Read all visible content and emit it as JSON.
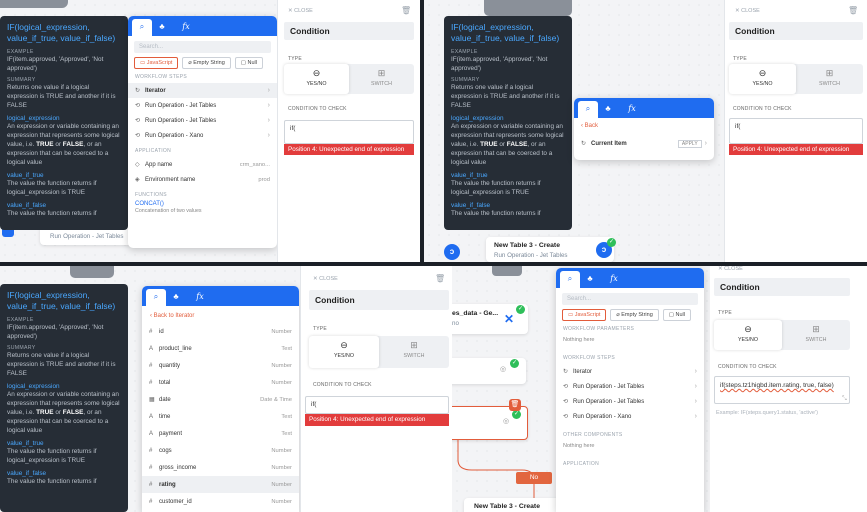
{
  "tooltip": {
    "title": "IF(logical_expression, value_if_true, value_if_false)",
    "example_h": "EXAMPLE",
    "example": "IF(item.approved, 'Approved', 'Not approved')",
    "summary_h": "SUMMARY",
    "summary": "Returns one value if a logical expression is TRUE and another if it is FALSE",
    "p1": "logical_expression",
    "p1d_a": "An expression or variable containing an expression that represents some logical value, i.e. ",
    "p1d_true": "TRUE",
    "p1d_or": " or ",
    "p1d_false": "FALSE",
    "p1d_b": ", or an expression that can be coerced to a logical value",
    "p2": "value_if_true",
    "p2d": "The value the function returns if logical_expression is TRUE",
    "p3": "value_if_false",
    "p3d": "The value the function returns if"
  },
  "popup": {
    "tab_fx": "fx",
    "search_placeholder": "Search...",
    "chip_js": "JavaScript",
    "chip_empty": "Empty String",
    "chip_null": "Null",
    "workflow_steps": "WORKFLOW STEPS",
    "workflow_params": "WORKFLOW PARAMETERS",
    "nothing_here": "Nothing here",
    "other_components": "OTHER COMPONENTS",
    "steps": [
      "Iterator",
      "Run Operation - Jet Tables",
      "Run Operation - Jet Tables",
      "Run Operation - Xano"
    ],
    "steps_q4": [
      "Iterator",
      "Run Operation - Jet Tables",
      "Run Operation - Jet Tables",
      "Run Operation - Xano"
    ],
    "application": "APPLICATION",
    "app_rows": [
      {
        "label": "App name",
        "value": "crm_xano..."
      },
      {
        "label": "Environment name",
        "value": "prod"
      }
    ],
    "functions": "FUNCTIONS",
    "concat": "CONCAT()",
    "concat_d": "Concatenation of two values",
    "back": "Back",
    "current_item": "Current Item",
    "apply": "APPLY",
    "back_iter": "Back to Iterator",
    "fields": [
      {
        "icon": "#",
        "label": "id",
        "type": "Number"
      },
      {
        "icon": "A",
        "label": "product_line",
        "type": "Text"
      },
      {
        "icon": "#",
        "label": "quantity",
        "type": "Number"
      },
      {
        "icon": "#",
        "label": "total",
        "type": "Number"
      },
      {
        "icon": "▦",
        "label": "date",
        "type": "Date & Time"
      },
      {
        "icon": "A",
        "label": "time",
        "type": "Text"
      },
      {
        "icon": "A",
        "label": "payment",
        "type": "Text"
      },
      {
        "icon": "#",
        "label": "cogs",
        "type": "Number"
      },
      {
        "icon": "#",
        "label": "gross_income",
        "type": "Number"
      },
      {
        "icon": "#",
        "label": "rating",
        "type": "Number"
      },
      {
        "icon": "#",
        "label": "customer_id",
        "type": "Number"
      }
    ]
  },
  "panel": {
    "close": "CLOSE",
    "title": "Condition",
    "type_label": "TYPE",
    "yesno": "YES/NO",
    "switch": "SWITCH",
    "cond_label": "CONDITION TO CHECK",
    "expr": "if(",
    "expr_q4": "if(steps.tz1higbd.item.rating, true, false)",
    "error": "Position 4: Unexpected end of expression",
    "example": "Example: IF(steps.query1.status, 'active')"
  },
  "nodes": {
    "run_jet": "Run Operation - Jet Tables",
    "new_table": "New Table 3 - Create",
    "run_jet2": "Run Operation - Jet Tables",
    "es_data": "es_data - Ge...",
    "es_sub": "no",
    "no_label": "No"
  }
}
